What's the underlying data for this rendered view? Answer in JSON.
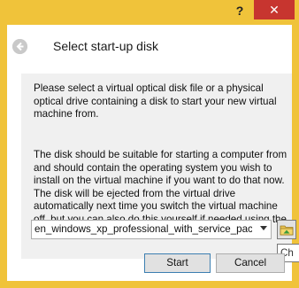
{
  "window": {
    "help_glyph": "?",
    "close_glyph": "✕",
    "accent": "#f0c33a",
    "close_color": "#c7352f"
  },
  "wizard": {
    "title": "Select start-up disk",
    "paragraph1": "Please select a virtual optical disk file or a physical optical drive containing a disk to start your new virtual machine from.",
    "paragraph2": "The disk should be suitable for starting a computer from and should contain the operating system you wish to install on the virtual machine if you want to do that now. The disk will be ejected from the virtual drive automatically next time you switch the virtual machine off, but you can also do this yourself if needed using the Devices menu."
  },
  "disk_select": {
    "value": "en_windows_xp_professional_with_service_pac",
    "icons": {
      "dropdown": "chevron-down-icon",
      "browse": "folder-icon"
    }
  },
  "tooltip": {
    "text": "Ch"
  },
  "buttons": {
    "start": "Start",
    "cancel": "Cancel"
  }
}
